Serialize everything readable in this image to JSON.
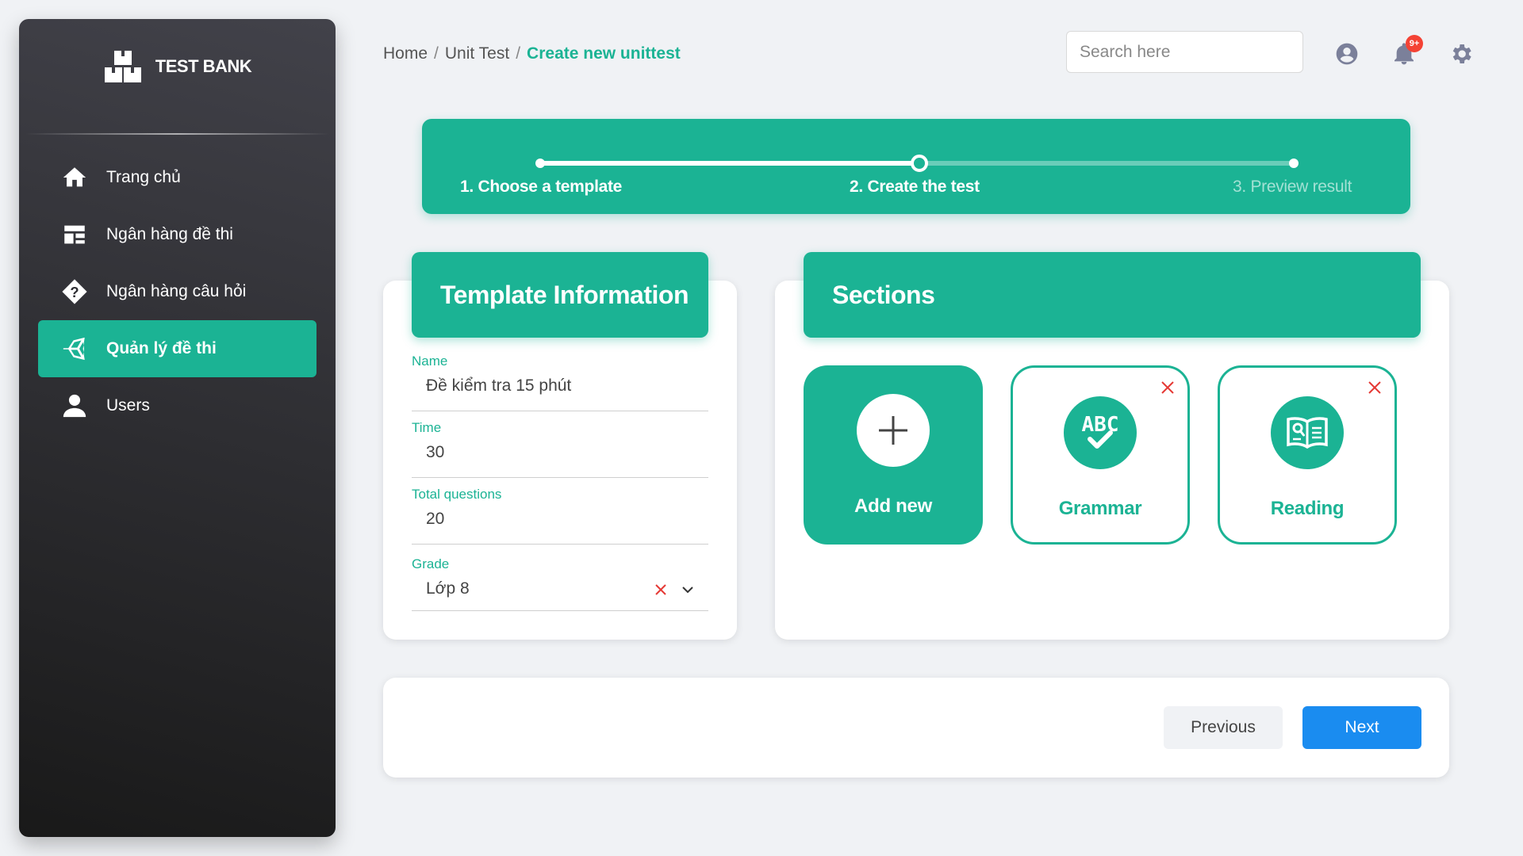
{
  "brand": {
    "name": "TEST BANK"
  },
  "sidebar": {
    "items": [
      {
        "label": "Trang chủ",
        "icon": "home-icon"
      },
      {
        "label": "Ngân hàng đề thi",
        "icon": "layout-icon"
      },
      {
        "label": "Ngân hàng câu hỏi",
        "icon": "question-icon"
      },
      {
        "label": "Quản lý đề thi",
        "icon": "unity-icon",
        "active": true
      },
      {
        "label": "Users",
        "icon": "user-icon"
      }
    ]
  },
  "header": {
    "breadcrumb": [
      "Home",
      "Unit Test",
      "Create new unittest"
    ],
    "search_placeholder": "Search here",
    "notification_badge": "9+"
  },
  "stepper": {
    "steps": [
      {
        "label": "1. Choose a template",
        "state": "done"
      },
      {
        "label": "2. Create the test",
        "state": "current"
      },
      {
        "label": "3. Preview result",
        "state": "pending"
      }
    ]
  },
  "template_info": {
    "title": "Template Information",
    "fields": {
      "name": {
        "label": "Name",
        "value": "Đề kiểm tra 15 phút"
      },
      "time": {
        "label": "Time",
        "value": "30"
      },
      "total_questions": {
        "label": "Total questions",
        "value": "20"
      },
      "grade": {
        "label": "Grade",
        "value": "Lớp 8"
      }
    }
  },
  "sections": {
    "title": "Sections",
    "add_label": "Add new",
    "items": [
      {
        "label": "Grammar",
        "icon": "abc-check-icon"
      },
      {
        "label": "Reading",
        "icon": "open-book-icon"
      }
    ]
  },
  "footer": {
    "previous_label": "Previous",
    "next_label": "Next"
  },
  "colors": {
    "accent": "#1bb394",
    "primary_button": "#1a8cf0",
    "sidebar_dark": "#191919",
    "badge": "#f44335",
    "delete": "#e53935"
  }
}
